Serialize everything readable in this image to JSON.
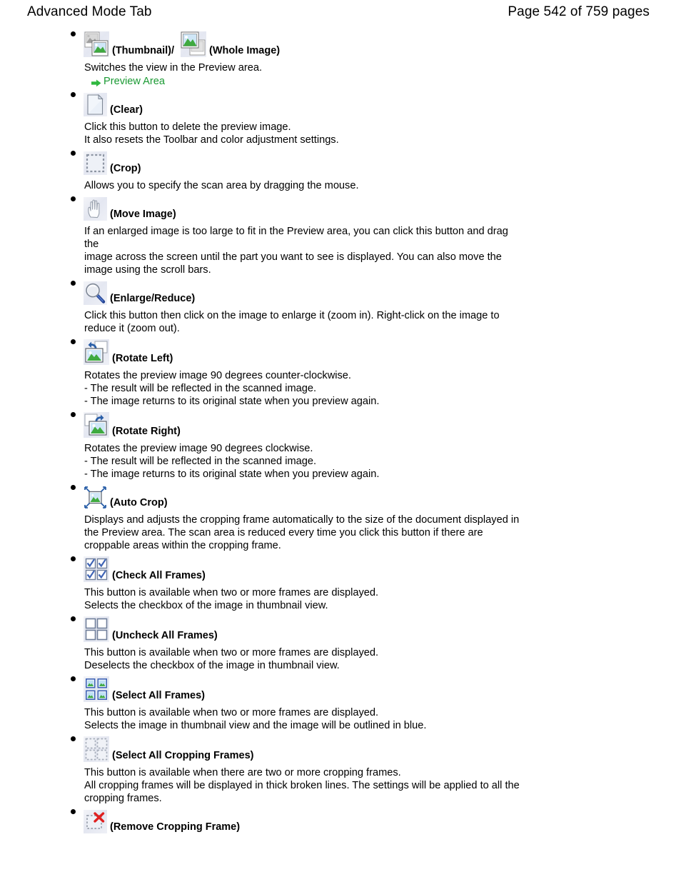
{
  "header": {
    "title": "Advanced Mode Tab",
    "page_label": "Page 542 of 759 pages"
  },
  "entries": [
    {
      "id": "thumbnail-whole-image",
      "icons": [
        "thumbnail-icon",
        "whole-image-icon"
      ],
      "label": "(Thumbnail)/",
      "label2": "(Whole Image)",
      "desc": [
        "Switches the view in the Preview area."
      ],
      "link": "Preview Area"
    },
    {
      "id": "clear",
      "icons": [
        "clear-icon"
      ],
      "label": "(Clear)",
      "desc": [
        "Click this button to delete the preview image.",
        "It also resets the Toolbar and color adjustment settings."
      ]
    },
    {
      "id": "crop",
      "icons": [
        "crop-icon"
      ],
      "label": "(Crop)",
      "desc": [
        "Allows you to specify the scan area by dragging the mouse."
      ]
    },
    {
      "id": "move-image",
      "icons": [
        "move-image-icon"
      ],
      "label": "(Move Image)",
      "desc": [
        "If an enlarged image is too large to fit in the Preview area, you can click this button and drag the",
        "image across the screen until the part you want to see is displayed. You can also move the",
        "image using the scroll bars."
      ]
    },
    {
      "id": "enlarge-reduce",
      "icons": [
        "enlarge-reduce-icon"
      ],
      "label": "(Enlarge/Reduce)",
      "desc": [
        "Click this button then click on the image to enlarge it (zoom in). Right-click on the image to",
        "reduce it (zoom out)."
      ]
    },
    {
      "id": "rotate-left",
      "icons": [
        "rotate-left-icon"
      ],
      "label": "(Rotate Left)",
      "desc": [
        "Rotates the preview image 90 degrees counter-clockwise.",
        "- The result will be reflected in the scanned image.",
        "- The image returns to its original state when you preview again."
      ]
    },
    {
      "id": "rotate-right",
      "icons": [
        "rotate-right-icon"
      ],
      "label": "(Rotate Right)",
      "desc": [
        "Rotates the preview image 90 degrees clockwise.",
        "- The result will be reflected in the scanned image.",
        "- The image returns to its original state when you preview again."
      ]
    },
    {
      "id": "auto-crop",
      "icons": [
        "auto-crop-icon"
      ],
      "label": "(Auto Crop)",
      "desc": [
        "Displays and adjusts the cropping frame automatically to the size of the document displayed in",
        "the Preview area. The scan area is reduced every time you click this button if there are",
        "croppable areas within the cropping frame."
      ]
    },
    {
      "id": "check-all-frames",
      "icons": [
        "check-all-frames-icon"
      ],
      "label": "(Check All Frames)",
      "desc": [
        "This button is available when two or more frames are displayed.",
        "Selects the checkbox of the image in thumbnail view."
      ]
    },
    {
      "id": "uncheck-all-frames",
      "icons": [
        "uncheck-all-frames-icon"
      ],
      "label": "(Uncheck All Frames)",
      "desc": [
        "This button is available when two or more frames are displayed.",
        "Deselects the checkbox of the image in thumbnail view."
      ]
    },
    {
      "id": "select-all-frames",
      "icons": [
        "select-all-frames-icon"
      ],
      "label": "(Select All Frames)",
      "desc": [
        "This button is available when two or more frames are displayed.",
        "Selects the image in thumbnail view and the image will be outlined in blue."
      ]
    },
    {
      "id": "select-all-cropping-frames",
      "icons": [
        "select-all-cropping-frames-icon"
      ],
      "label": "(Select All Cropping Frames)",
      "desc": [
        "This button is available when there are two or more cropping frames.",
        "All cropping frames will be displayed in thick broken lines. The settings will be applied to all the",
        "cropping frames."
      ]
    },
    {
      "id": "remove-cropping-frame",
      "icons": [
        "remove-cropping-frame-icon"
      ],
      "label": "(Remove Cropping Frame)",
      "desc": []
    }
  ],
  "colors": {
    "link_green": "#1a9a33",
    "icon_blue": "#2a5fa8",
    "photo_green": "#3faa3f",
    "remove_red": "#e02020",
    "text": "#000000"
  }
}
